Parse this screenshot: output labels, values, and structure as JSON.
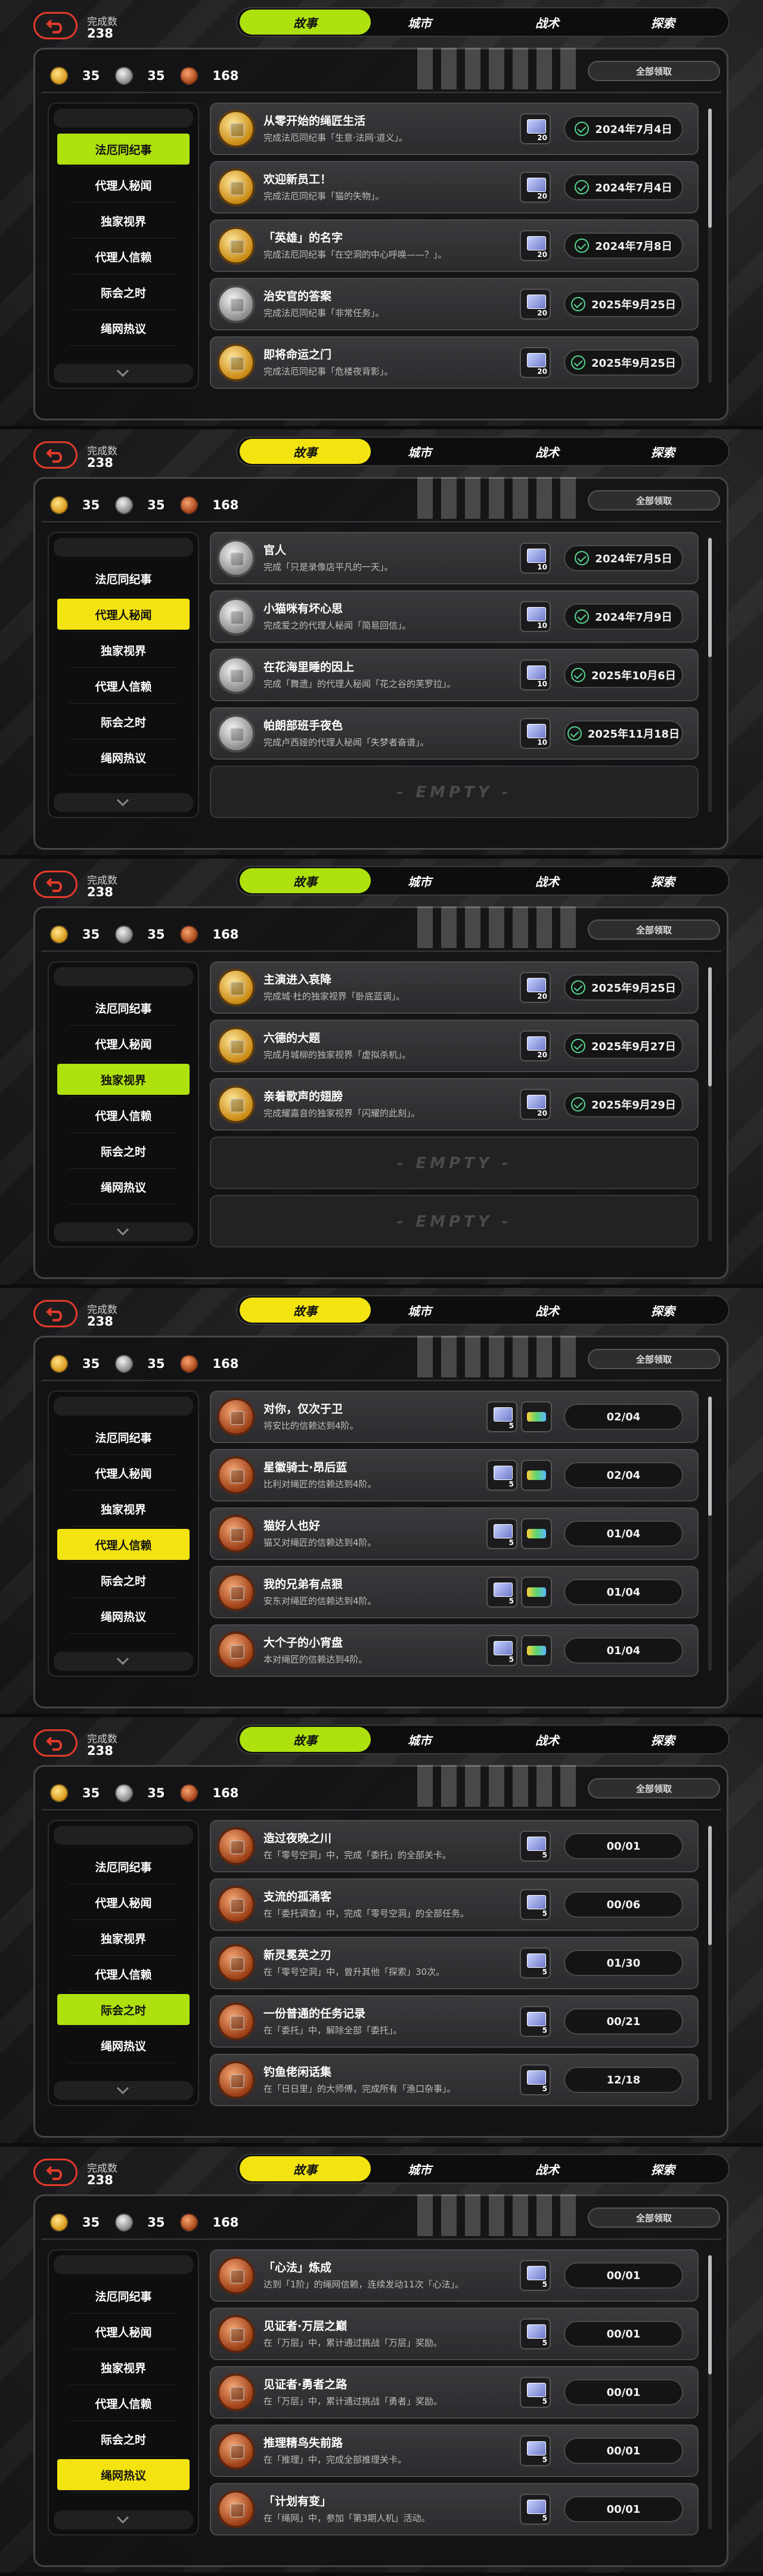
{
  "colors": {
    "accent_yellow": "#f3e411",
    "accent_lime": "#aee10e",
    "back_red": "#e23a2a",
    "check_green": "#57d68d"
  },
  "icons": {
    "back": "back-arrow-icon",
    "coin_gold": "gold-coin-icon",
    "coin_silver": "silver-coin-icon",
    "coin_bronze": "bronze-coin-icon",
    "medal": "medal-icon",
    "reward": "reward-card-icon",
    "check": "check-icon",
    "chevron": "chevron-down-icon"
  },
  "common": {
    "complete_label": "完成数",
    "complete_count": "238",
    "tabs": [
      "故事",
      "城市",
      "战术",
      "探索"
    ],
    "currency": {
      "gold": "35",
      "silver": "35",
      "bronze": "168"
    },
    "claim_all": "全部领取",
    "sidebar": [
      "法厄同纪事",
      "代理人秘闻",
      "独家视界",
      "代理人信赖",
      "际会之时",
      "绳网热议"
    ],
    "empty_text": "EMPTY"
  },
  "panels": [
    {
      "active_tab": 0,
      "tab_color": "#aee10e",
      "active_side": 0,
      "entries": [
        {
          "medal": "gold",
          "title": "从零开始的绳匠生活",
          "desc": "完成法厄同纪事「生意·法网·道义」。",
          "reward": "20",
          "status": "2024年7月4日",
          "type": "date"
        },
        {
          "medal": "gold",
          "title": "欢迎新员工！",
          "desc": "完成法厄同纪事「猫的失物」。",
          "reward": "20",
          "status": "2024年7月4日",
          "type": "date"
        },
        {
          "medal": "gold",
          "title": "「英雄」的名字",
          "desc": "完成法厄同纪事「在空洞的中心呼唤——？」。",
          "reward": "20",
          "status": "2024年7月8日",
          "type": "date"
        },
        {
          "medal": "silver",
          "title": "治安官的答案",
          "desc": "完成法厄同纪事「非常任务」。",
          "reward": "20",
          "status": "2025年9月25日",
          "type": "date"
        },
        {
          "medal": "gold",
          "title": "即将命运之门",
          "desc": "完成法厄同纪事「危楼夜背影」。",
          "reward": "20",
          "status": "2025年9月25日",
          "type": "date"
        }
      ],
      "empties": 0
    },
    {
      "active_tab": 0,
      "tab_color": "#f3e411",
      "active_side": 1,
      "entries": [
        {
          "medal": "silver",
          "title": "官人",
          "desc": "完成「只是录像店平凡的一天」。",
          "reward": "10",
          "status": "2024年7月5日",
          "type": "date"
        },
        {
          "medal": "silver",
          "title": "小猫咪有坏心思",
          "desc": "完成爱之的代理人秘闻「简易回信」。",
          "reward": "10",
          "status": "2024年7月9日",
          "type": "date"
        },
        {
          "medal": "silver",
          "title": "在花海里睡的因上",
          "desc": "完成「舞遗」的代理人秘闻「花之谷的芙罗拉」。",
          "reward": "10",
          "status": "2025年10月6日",
          "type": "date"
        },
        {
          "medal": "silver",
          "title": "帕朗部班手夜色",
          "desc": "完成卢西娅的代理人秘闻「失梦者奋谱」。",
          "reward": "10",
          "status": "2025年11月18日",
          "type": "date"
        }
      ],
      "empties": 1
    },
    {
      "active_tab": 0,
      "tab_color": "#aee10e",
      "active_side": 2,
      "entries": [
        {
          "medal": "gold",
          "title": "主演进入哀降",
          "desc": "完成城·杜的独家视界「卧底蓝调」。",
          "reward": "20",
          "status": "2025年9月25日",
          "type": "date"
        },
        {
          "medal": "gold",
          "title": "六德的大题",
          "desc": "完成月城柳的独家视界「虚拟杀机」。",
          "reward": "20",
          "status": "2025年9月27日",
          "type": "date"
        },
        {
          "medal": "gold",
          "title": "亲着歌声的翅膀",
          "desc": "完成耀嘉音的独家视界「闪耀的此刻」。",
          "reward": "20",
          "status": "2025年9月29日",
          "type": "date"
        }
      ],
      "empties": 2
    },
    {
      "active_tab": 0,
      "tab_color": "#f3e411",
      "active_side": 3,
      "entries": [
        {
          "medal": "bronze",
          "title": "对你，仅次于卫",
          "desc": "将安比的信赖达到4阶。",
          "reward": "5",
          "status": "02/04",
          "type": "progress"
        },
        {
          "medal": "bronze",
          "title": "星徽骑士·昂后蓝",
          "desc": "比利对绳匠的信赖达到4阶。",
          "reward": "5",
          "status": "02/04",
          "type": "progress"
        },
        {
          "medal": "bronze",
          "title": "猫好人也好",
          "desc": "猫又对绳匠的信赖达到4阶。",
          "reward": "5",
          "status": "01/04",
          "type": "progress"
        },
        {
          "medal": "bronze",
          "title": "我的兄弟有点狠",
          "desc": "安东对绳匠的信赖达到4阶。",
          "reward": "5",
          "status": "01/04",
          "type": "progress"
        },
        {
          "medal": "bronze",
          "title": "大个子的小宵盘",
          "desc": "本对绳匠的信赖达到4阶。",
          "reward": "5",
          "status": "01/04",
          "type": "progress"
        }
      ],
      "empties": 0
    },
    {
      "active_tab": 0,
      "tab_color": "#aee10e",
      "active_side": 4,
      "entries": [
        {
          "medal": "bronze",
          "title": "造过夜晚之川",
          "desc": "在「零号空洞」中，完成「委托」的全部关卡。",
          "reward": "5",
          "status": "00/01",
          "type": "progress"
        },
        {
          "medal": "bronze",
          "title": "支流的孤涌客",
          "desc": "在「委托调查」中，完成「零号空洞」的全部任务。",
          "reward": "5",
          "status": "00/06",
          "type": "progress"
        },
        {
          "medal": "bronze",
          "title": "新灵冕英之刃",
          "desc": "在「零号空洞」中，曾升其他「探索」30次。",
          "reward": "5",
          "status": "01/30",
          "type": "progress"
        },
        {
          "medal": "bronze",
          "title": "一份普通的任务记录",
          "desc": "在「委托」中，解除全部「委托」。",
          "reward": "5",
          "status": "00/21",
          "type": "progress"
        },
        {
          "medal": "bronze",
          "title": "钓鱼佬闲话集",
          "desc": "在「日日里」的大师傅，完成所有「渔口杂事」。",
          "reward": "5",
          "status": "12/18",
          "type": "progress"
        }
      ],
      "empties": 0
    },
    {
      "active_tab": 0,
      "tab_color": "#f3e411",
      "active_side": 5,
      "entries": [
        {
          "medal": "bronze",
          "title": "「心法」炼成",
          "desc": "达到「1阶」的绳网信赖，连续发动11次「心法」。",
          "reward": "5",
          "status": "00/01",
          "type": "progress"
        },
        {
          "medal": "bronze",
          "title": "见证者·万层之巅",
          "desc": "在「万层」中，累计通过挑战「万层」奖励。",
          "reward": "5",
          "status": "00/01",
          "type": "progress"
        },
        {
          "medal": "bronze",
          "title": "见证者·勇者之路",
          "desc": "在「万层」中，累计通过挑战「勇者」奖励。",
          "reward": "5",
          "status": "00/01",
          "type": "progress"
        },
        {
          "medal": "bronze",
          "title": "推理精鸟失前路",
          "desc": "在「推理」中，完成全部推理关卡。",
          "reward": "5",
          "status": "00/01",
          "type": "progress"
        },
        {
          "medal": "bronze",
          "title": "「计划有变」",
          "desc": "在「绳网」中，参加「第3期人机」活动。",
          "reward": "5",
          "status": "00/01",
          "type": "progress"
        }
      ],
      "empties": 0
    }
  ]
}
